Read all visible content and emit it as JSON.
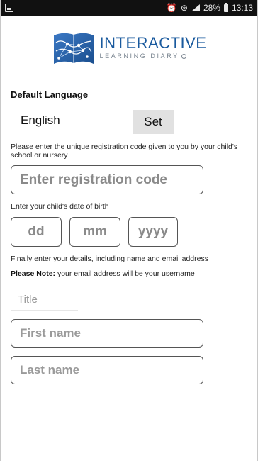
{
  "status_bar": {
    "battery_percent": "28%",
    "time": "13:13",
    "icons": [
      "notification-square-icon",
      "alarm-icon",
      "wifi-icon",
      "signal-icon",
      "battery-icon"
    ]
  },
  "logo": {
    "title": "INTERACTIVE",
    "subtitle": "LEARNING DIARY"
  },
  "language": {
    "label": "Default Language",
    "value": "English",
    "set_button": "Set"
  },
  "registration": {
    "instructions": "Please enter the unique registration code given to you by your child's school or nursery",
    "placeholder": "Enter registration code"
  },
  "dob": {
    "label": "Enter your child's date of birth",
    "day_placeholder": "dd",
    "month_placeholder": "mm",
    "year_placeholder": "yyyy"
  },
  "details": {
    "instructions": "Finally enter your details, including name and email address",
    "note_label": "Please Note:",
    "note_text": " your email address will be your username",
    "title_placeholder": "Title",
    "first_name_placeholder": "First name",
    "last_name_placeholder": "Last name"
  },
  "colors": {
    "brand_blue": "#1a5a9e",
    "status_bar": "#111111",
    "button_gray": "#e1e1e1"
  }
}
